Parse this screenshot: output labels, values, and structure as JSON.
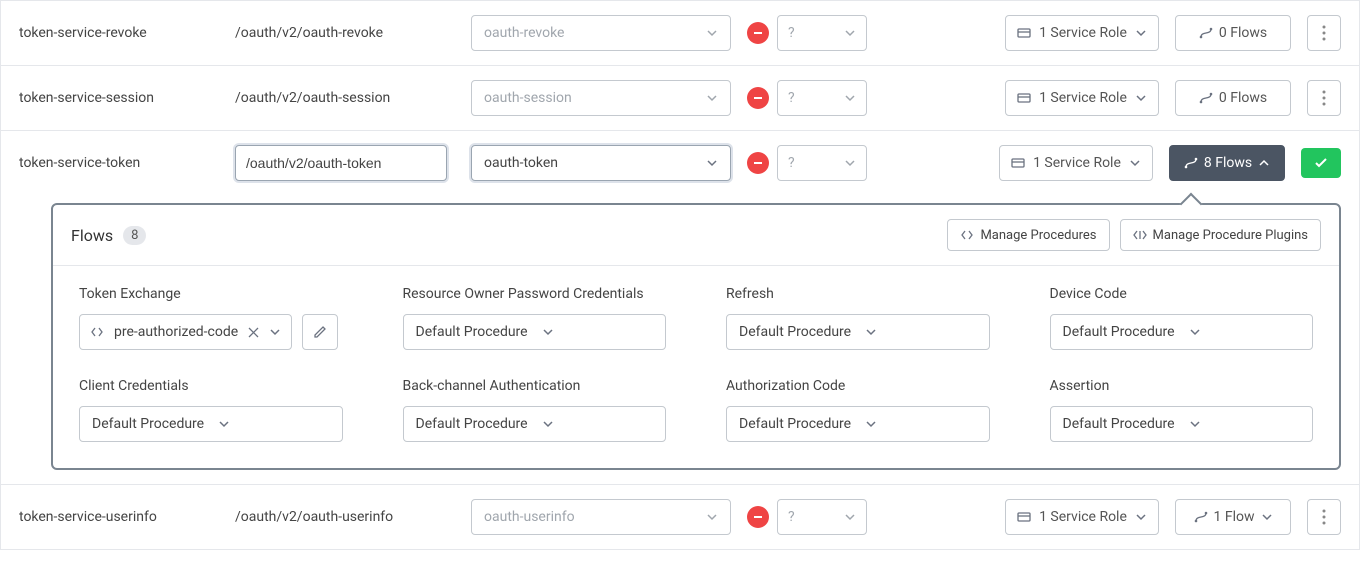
{
  "rows": [
    {
      "name": "token-service-revoke",
      "path": "/oauth/v2/oauth-revoke",
      "select": "oauth-revoke",
      "status": "?",
      "role": "1 Service Role",
      "flows": "0 Flows"
    },
    {
      "name": "token-service-session",
      "path": "/oauth/v2/oauth-session",
      "select": "oauth-session",
      "status": "?",
      "role": "1 Service Role",
      "flows": "0 Flows"
    },
    {
      "name": "token-service-token",
      "path": "/oauth/v2/oauth-token",
      "select": "oauth-token",
      "status": "?",
      "role": "1 Service Role",
      "flows": "8 Flows"
    },
    {
      "name": "token-service-userinfo",
      "path": "/oauth/v2/oauth-userinfo",
      "select": "oauth-userinfo",
      "status": "?",
      "role": "1 Service Role",
      "flows": "1 Flow"
    }
  ],
  "flowsPanel": {
    "title": "Flows",
    "count": "8",
    "manageProcedures": "Manage Procedures",
    "managePlugins": "Manage Procedure Plugins",
    "tokenExchange": {
      "label": "Token Exchange",
      "value": "pre-authorized-code"
    },
    "items": [
      {
        "label": "Resource Owner Password Credentials",
        "value": "Default Procedure"
      },
      {
        "label": "Refresh",
        "value": "Default Procedure"
      },
      {
        "label": "Device Code",
        "value": "Default Procedure"
      },
      {
        "label": "Client Credentials",
        "value": "Default Procedure"
      },
      {
        "label": "Back-channel Authentication",
        "value": "Default Procedure"
      },
      {
        "label": "Authorization Code",
        "value": "Default Procedure"
      },
      {
        "label": "Assertion",
        "value": "Default Procedure"
      }
    ]
  }
}
